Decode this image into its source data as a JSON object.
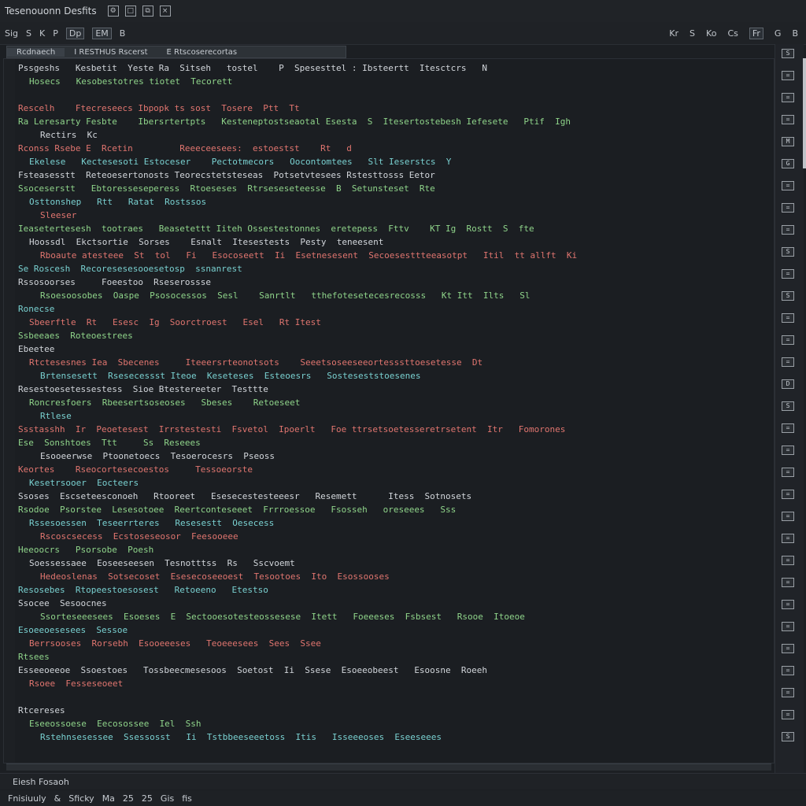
{
  "window": {
    "title": "Tesenouonn Desfits"
  },
  "toolbar": {
    "left": [
      "Sig",
      "S",
      "K",
      "P",
      "Dp",
      "EM",
      "B"
    ],
    "right": [
      "Kr",
      "S",
      "Ko",
      "Cs",
      "Fr",
      "G",
      "B"
    ]
  },
  "tabs": [
    {
      "label": "Rcdnaech"
    },
    {
      "label": "I RESTHUS Rscerst"
    },
    {
      "label": "E Rtscoserecortas"
    }
  ],
  "code": {
    "lines": [
      "Pssgeshs   Kesbetit  Yeste Ra  Sitseh   tostel    P  Spesesttel : Ibsteertt  Itesctcrs   N",
      "Hosecs   Kesobestotres tiotet  Tecorett",
      "",
      "Rescelh    Ftecreseecs Ibpopk ts sost  Tosere  Ptt  Tt",
      "Ra Leresarty Fesbte    Ibersrtertpts   Kesteneptostseaotal Esesta  S  Itesertostebesh Iefesete   Ptif  Igh",
      "Rectirs  Kc",
      "Rconss Rsebe E  Rcetin         Reeeceesees:  estoestst    Rt   d",
      "Ekelese   Kectesesoti Estoceser    Pectotmecors   Oocontomtees   Slt Ieserstcs  Y",
      "Fsteasesstt  Reteoesertonosts Teorecstetsteseas  Potsetvtesees Rstesttosss Eetor",
      "Ssoceserstt   Ebtoresseseperess  Rtoeseses  Rtrseseseteesse  B  Setunsteset  Rte",
      "Osttonshep   Rtt   Ratat  Rostssos",
      "Sleeser",
      "Ieasetertesesh  tootraes   Beasetettt Iiteh Ossestestonnes  eretepess  Fttv    KT Ig  Rostt  S  fte",
      "Hoossdl  Ekctsortie  Sorses    Esnalt  Itesestests  Pesty  teneesent",
      "Rboaute atesteee  St  tol   Fi   Esocoseett  Ii  Esetnesesent  Secoesesttteeasotpt   Itil  tt allft  Ki",
      "Se Roscesh  Recoresesesooesetosp  ssnanrest",
      "Rssosoorses     Foeestoo  Rseserossse",
      "Rsoesoosobes  Oaspe  Psosocessos  Sesl    Sanrtlt   tthefotesetecesrecosss   Kt Itt  Ilts   Sl",
      "Ronecse",
      "Sbeerftle  Rt   Esesc  Ig  Soorctroest   Esel   Rt Itest",
      "Ssbeeaes  Roteoestrees",
      "Ebeetee",
      "Rtctesesnes Iea  Sbecenes     Iteeersrteonotsots    Seeetsoseeseeortesssttoesetesse  Dt",
      "Brtensesett  Rsesecessst Iteoe  Keseteses  Esteoesrs   Sosteseststoesenes",
      "Resestoesetessestess  Sioe Btestereeter  Testtte",
      "Roncresfoers  Rbeesertsoseoses   Sbeses    Retoeseet",
      "Rtlese",
      "Ssstasshh  Ir  Peoetesest  Irrstestesti  Fsvetol  Ipoerlt   Foe ttrsetsoetesseretrsetent  Itr   Fomorones",
      "Ese  Sonshtoes  Ttt     Ss  Reseees",
      "Esooeerwse  Ptoonetoecs  Tesoerocesrs  Pseoss",
      "Keortes    Rseocortesecoestos     Tessoeorste",
      "Kesetrsooer  Eocteers",
      "Ssoses  Escseteesconoeh   Rtooreet   Esesecestesteeesr   Resemett      Itess  Sotnosets",
      "Rsodoe  Psorstee  Lesesotoee  Reertconteseeet  Frrroessoe   Fsosseh   oreseees   Sss",
      "Rssesoessen  Teseerrteres   Resesestt  Oesecess",
      "Rscoscsecess  Ecstoseseosor  Feesooeee",
      "Heeoocrs   Psorsobe  Poesh",
      "Soessessaee  Eoseeseesen  Tesnotttss  Rs   Sscvoemt",
      "Hedeoslenas  Sotsecoset  Esesecoseeoest  Tesootoes  Ito  Esossooses",
      "Resosebes  Rtopeestoesosest   Retoeeno   Etestso",
      "Ssocee  Sesoocnes",
      "Ssorteseeesees  Esoeses  E  Sectooesotesteossesese  Itett   Foeeeses  Fsbsest   Rsooe  Itoeoe",
      "Esoeeoesesees  Sessoe",
      "Berrsooses  Rorsebh  Esooeeeses   Teoeeesees  Sees  Ssee",
      "Rtsees",
      "Esseeoeeoe  Ssoestoes   Tossbeecmesesoos  Soetost  Ii  Ssese  Esoeeobeest   Esoosne  Roeeh",
      "Rsoee  Fesseseoeet",
      "",
      "Rtcereses",
      "Eseeossoese  Eecosossee  Iel  Ssh",
      "Rstehnsesessee  Ssessosst   Ii  Tstbbeeseeetoss  Itis   Isseeeoses  Eseeseees"
    ]
  },
  "rightpanel": {
    "icons": [
      "S",
      "=",
      "=",
      "=",
      "M",
      "G",
      "=",
      "=",
      "=",
      "S",
      "=",
      "S",
      "=",
      "=",
      "=",
      "D",
      "S",
      "=",
      "=",
      "=",
      "=",
      "=",
      "=",
      "=",
      "=",
      "=",
      "=",
      "=",
      "=",
      "=",
      "=",
      "S"
    ]
  },
  "statusbar": {
    "text": "Eiesh  Fosaoh"
  },
  "bottombar": {
    "items": [
      "Fnisiuuly",
      "&",
      "Sficky",
      "Ma",
      "25",
      "25",
      "Gis",
      "fis"
    ]
  }
}
